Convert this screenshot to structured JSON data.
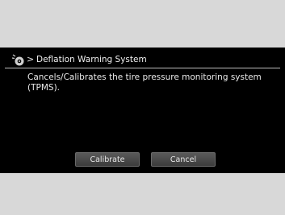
{
  "header": {
    "icon": "tire-pressure-icon",
    "breadcrumb_separator": ">",
    "title": "Deflation Warning System"
  },
  "body": {
    "description": "Cancels/Calibrates the tire pressure monitoring system (TPMS)."
  },
  "buttons": {
    "calibrate_label": "Calibrate",
    "cancel_label": "Cancel"
  },
  "colors": {
    "screen_background": "#000000",
    "page_background": "#d8d8d8",
    "text": "#f0f0f0",
    "button_fill": "#4a4a4a"
  }
}
